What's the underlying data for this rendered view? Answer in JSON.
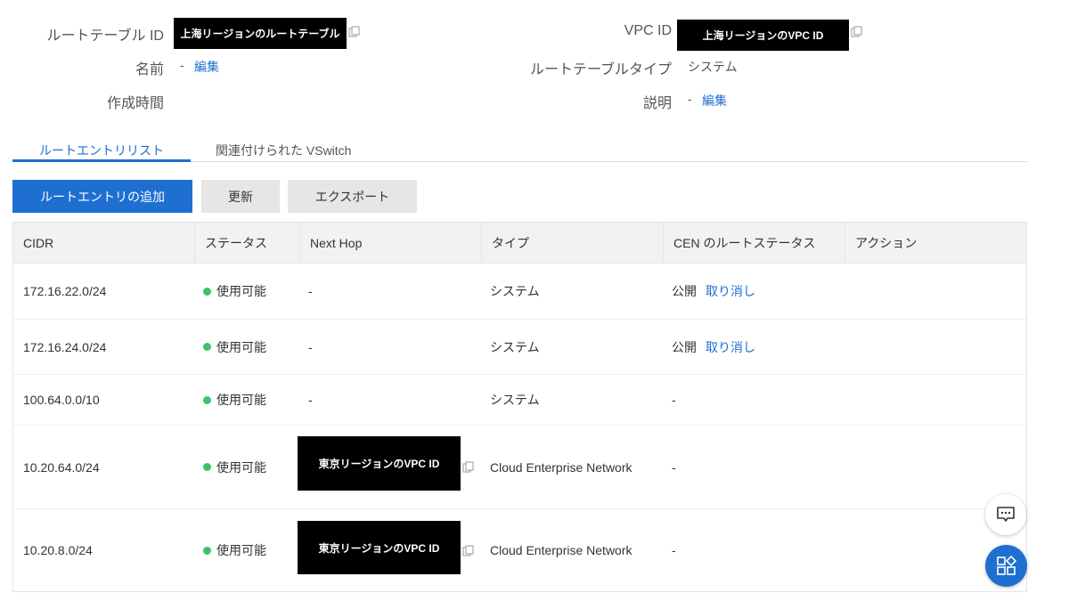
{
  "header": {
    "route_table_id_label": "ルートテーブル ID",
    "route_table_id_value": "上海リージョンのルートテーブル",
    "name_label": "名前",
    "name_value": "-",
    "name_edit": "編集",
    "created_label": "作成時間",
    "vpc_id_label": "VPC ID",
    "vpc_id_value": "上海リージョンのVPC ID",
    "route_table_type_label": "ルートテーブルタイプ",
    "route_table_type_value": "システム",
    "description_label": "説明",
    "description_value": "-",
    "description_edit": "編集"
  },
  "tabs": [
    {
      "label": "ルートエントリリスト",
      "active": true
    },
    {
      "label": "関連付けられた VSwitch",
      "active": false
    }
  ],
  "toolbar": {
    "add_label": "ルートエントリの追加",
    "refresh_label": "更新",
    "export_label": "エクスポート"
  },
  "table": {
    "columns": [
      "CIDR",
      "ステータス",
      "Next Hop",
      "タイプ",
      "CEN のルートステータス",
      "アクション"
    ],
    "rows": [
      {
        "cidr": "172.16.22.0/24",
        "status": "使用可能",
        "next_hop": "-",
        "type": "システム",
        "cen_status": "公開",
        "cen_action": "取り消し"
      },
      {
        "cidr": "172.16.24.0/24",
        "status": "使用可能",
        "next_hop": "-",
        "type": "システム",
        "cen_status": "公開",
        "cen_action": "取り消し"
      },
      {
        "cidr": "100.64.0.0/10",
        "status": "使用可能",
        "next_hop": "-",
        "type": "システム",
        "cen_status": "-",
        "cen_action": ""
      },
      {
        "cidr": "10.20.64.0/24",
        "status": "使用可能",
        "next_hop": "東京リージョンのVPC ID",
        "type": "Cloud Enterprise Network",
        "cen_status": "-",
        "cen_action": ""
      },
      {
        "cidr": "10.20.8.0/24",
        "status": "使用可能",
        "next_hop": "東京リージョンのVPC ID",
        "type": "Cloud Enterprise Network",
        "cen_status": "-",
        "cen_action": ""
      }
    ]
  },
  "colors": {
    "accent": "#1f6fd1",
    "status_ok": "#3ec16b",
    "redaction": "#000000"
  },
  "icons": {
    "copy": "copy-icon",
    "chat": "chat-icon",
    "apps": "apps-icon"
  }
}
